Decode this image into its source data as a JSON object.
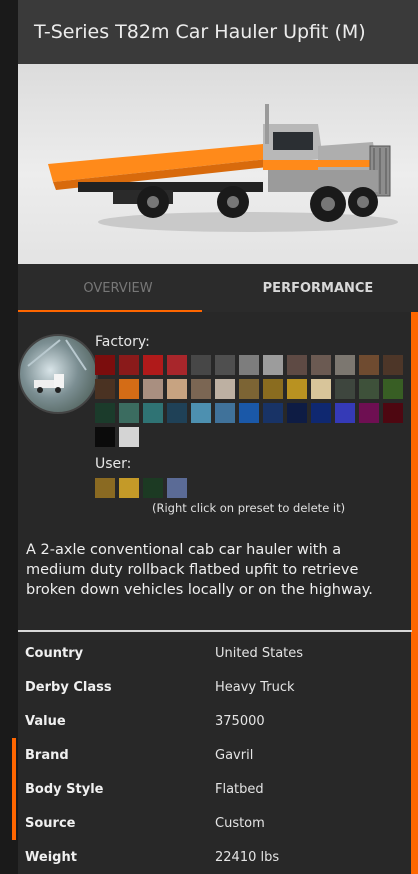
{
  "header": {
    "title": "T-Series T82m Car Hauler Upfit (M)"
  },
  "tabs": [
    {
      "label": "OVERVIEW",
      "active": false
    },
    {
      "label": "PERFORMANCE",
      "active": true
    }
  ],
  "colors": {
    "factory_label": "Factory:",
    "user_label": "User:",
    "factory": [
      "#7b0d0d",
      "#8a1a1a",
      "#b01a1a",
      "#a8262b",
      "#474747",
      "#4f4f4f",
      "#7d7d7d",
      "#9c9c9c",
      "#5e4a44",
      "#6b5a52",
      "#7c7770",
      "#6f4b30",
      "#4d3628",
      "#4a3222",
      "#d46c16",
      "#a98f80",
      "#c7a381",
      "#7b6653",
      "#bdb0a2",
      "#7c6434",
      "#8a6c1f",
      "#b99221",
      "#d8c59a",
      "#3e463e",
      "#3e513a",
      "#385e24",
      "#1b3b2b",
      "#3b6c60",
      "#2f7374",
      "#1f4157",
      "#4d90b0",
      "#40729a",
      "#1a58a8",
      "#183366",
      "#0e1c44",
      "#0f2870",
      "#353ab7",
      "#6e0f52",
      "#4e0711",
      "#0b0b0b",
      "#d4d4d4"
    ],
    "user": [
      "#8a6a22",
      "#c49a28",
      "#1c3a23",
      "#5b6b96"
    ],
    "hint": "(Right click on preset to delete it)"
  },
  "description": "A 2-axle conventional cab car hauler with a medium duty rollback flatbed upfit to retrieve broken down vehicles locally or on the highway.",
  "properties": [
    {
      "key": "Country",
      "value": "United States",
      "marked": false
    },
    {
      "key": "Derby Class",
      "value": "Heavy Truck",
      "marked": false
    },
    {
      "key": "Value",
      "value": "375000",
      "marked": false
    },
    {
      "key": "Brand",
      "value": "Gavril",
      "marked": true
    },
    {
      "key": "Body Style",
      "value": "Flatbed",
      "marked": true
    },
    {
      "key": "Source",
      "value": "Custom",
      "marked": true
    },
    {
      "key": "Weight",
      "value": "22410 lbs",
      "marked": false
    }
  ]
}
